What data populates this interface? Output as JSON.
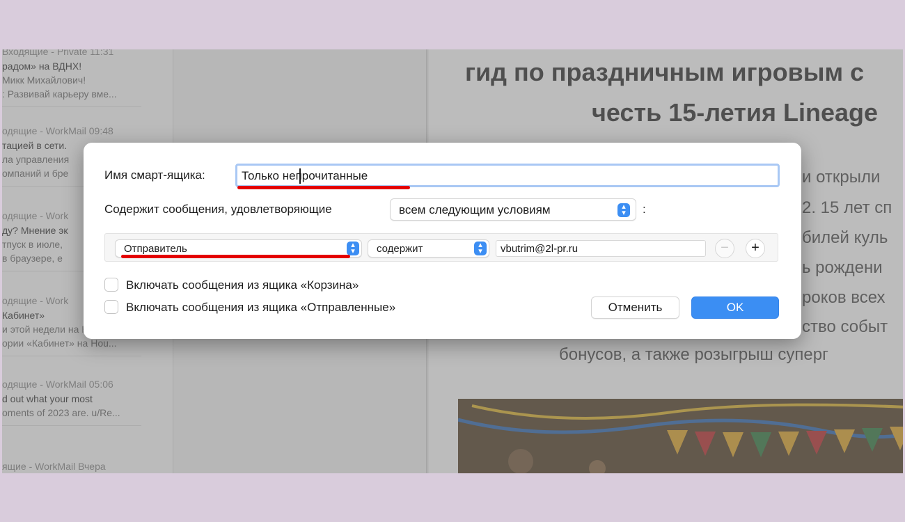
{
  "mail_list": {
    "items": [
      {
        "meta": "Входящие - Private  11:31",
        "lines": [
          "радом» на ВДНХ!",
          "Микк Михайлович!",
          ": Развивай карьеру вме..."
        ]
      },
      {
        "meta": "одящие - WorkMail  09:48",
        "lines": [
          "тацией в сети.",
          "ла управления",
          "омпаний и бре"
        ]
      },
      {
        "meta": "одящие - Work",
        "lines": [
          "ду? Мнение эк",
          "тпуск в июле,",
          "в браузере, е"
        ]
      },
      {
        "meta": "одящие - Work",
        "lines": [
          "Кабинет»",
          "и этой недели на Houzz",
          "ории «Кабинет» на Hou..."
        ]
      },
      {
        "meta": "одящие - WorkMail  05:06",
        "lines": [
          "d out what your most",
          "oments of 2023 are. u/Re..."
        ]
      },
      {
        "meta": "ящие - WorkMail  Вчера",
        "lines": []
      }
    ]
  },
  "reader": {
    "title_line1": "гид по праздничным игровым с",
    "title_line2": "честь 15-летия Lineage",
    "body_lines": [
      "и открыли",
      "2. 15 лет сп",
      "билей куль",
      "ь рождени",
      "роков всех",
      "ство событ",
      "бонусов, а также розыгрыш суперг"
    ]
  },
  "dialog": {
    "name_label": "Имя смарт-ящика:",
    "name_value": "Только непрочитанные",
    "contains_label": "Содержит сообщения, удовлетворяющие",
    "match_select": "всем следующим условиям",
    "colon": ":",
    "condition": {
      "field_select": "Отправитель",
      "operator_select": "содержит",
      "value": "vbutrim@2l-pr.ru"
    },
    "minus_label": "−",
    "plus_label": "+",
    "include_trash": "Включать сообщения из ящика «Корзина»",
    "include_sent": "Включать сообщения из ящика «Отправленные»",
    "cancel_label": "Отменить",
    "ok_label": "OK"
  },
  "colors": {
    "accent": "#3b8ef3",
    "annotation_red": "#e40000",
    "page_frame": "#d9ccdc"
  },
  "icons": {
    "stepper": "chevron-up-down-icon"
  }
}
